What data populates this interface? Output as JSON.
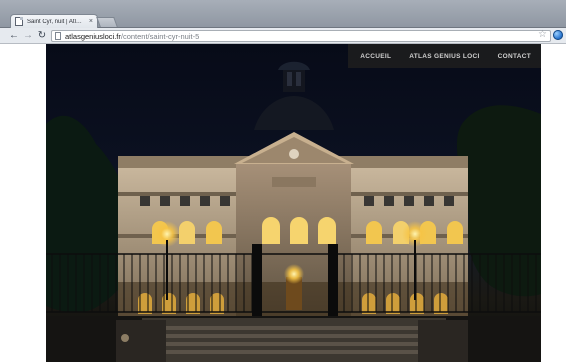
{
  "browser": {
    "tab_title": "Saint Cyr, nuit | Atlas Geni…",
    "tab_close": "×",
    "url_domain": "atlasgeniusloci.fr",
    "url_path": "/content/saint-cyr-nuit-5",
    "icons": {
      "back": "arrow-left",
      "forward": "arrow-right",
      "reload": "reload",
      "bookmark": "star",
      "extension": "globe"
    }
  },
  "site": {
    "nav": {
      "items": [
        {
          "label": "ACCUEIL"
        },
        {
          "label": "ATLAS GENIUS LOCI"
        },
        {
          "label": "CONTACT"
        }
      ]
    }
  },
  "colors": {
    "night_sky": "#070b18",
    "lamp_glow": "#f6c445",
    "stone": "#b7a58d"
  }
}
